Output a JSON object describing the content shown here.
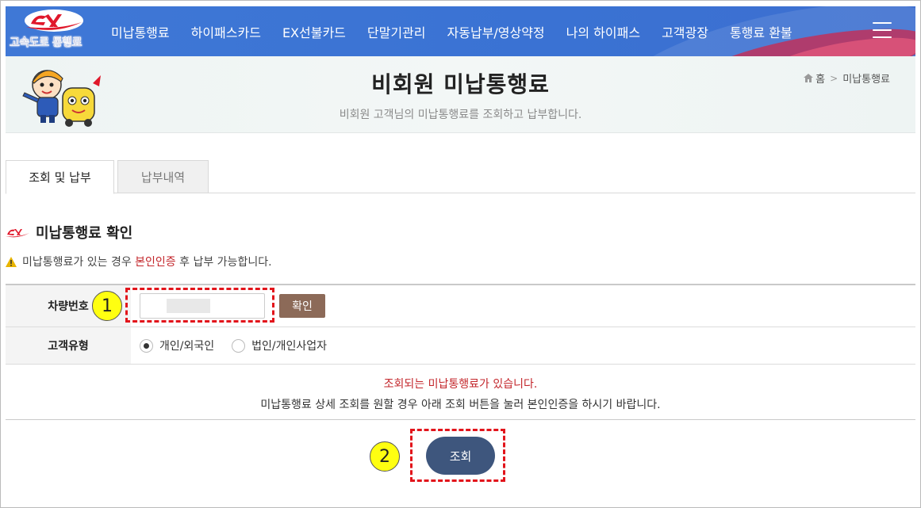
{
  "header": {
    "logo_text": "고속도로 통행료",
    "menu": [
      "미납통행료",
      "하이패스카드",
      "EX선불카드",
      "단말기관리",
      "자동납부/영상약정",
      "나의 하이패스",
      "고객광장",
      "통행료 환불"
    ],
    "accent_color": "#3f78d6"
  },
  "banner": {
    "title": "비회원 미납통행료",
    "subtitle": "비회원 고객님의 미납통행료를 조회하고 납부합니다.",
    "breadcrumb": {
      "home": "홈",
      "current": "미납통행료"
    }
  },
  "tabs": [
    {
      "label": "조회 및 납부",
      "active": true
    },
    {
      "label": "납부내역",
      "active": false
    }
  ],
  "section": {
    "title": "미납통행료 확인",
    "notice_pre": "미납통행료가 있는 경우 ",
    "notice_highlight": "본인인증",
    "notice_post": " 후 납부 가능합니다."
  },
  "form": {
    "car_label": "차량번호",
    "car_value": "",
    "confirm_label": "확인",
    "type_label": "고객유형",
    "options": [
      {
        "label": "개인/외국인",
        "selected": true
      },
      {
        "label": "법인/개인사업자",
        "selected": false
      }
    ]
  },
  "result": {
    "alert": "조회되는 미납통행료가 있습니다.",
    "description": "미납통행료 상세 조회를 원할 경우 아래 조회 버튼을 눌러 본인인증을 하시기 바랍니다."
  },
  "search_button": "조회",
  "annotations": {
    "badge_1": "1",
    "badge_2": "2"
  }
}
